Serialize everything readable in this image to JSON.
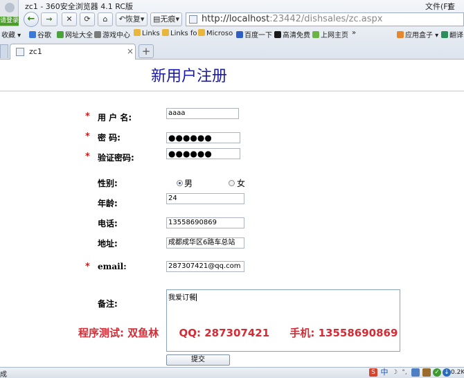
{
  "browser": {
    "window_title": "zc1 - 360安全浏览器 4.1 RC版",
    "menu_file": "文件(F)",
    "menu_view": "查",
    "login_label": "请登录",
    "restore_label": "恢复",
    "no_image_label": "无痕",
    "address": {
      "host": "http://localhost",
      "rest": ":23442/dishsales/zc.aspx"
    },
    "favorites": {
      "collect": "收藏",
      "items": [
        "谷歌",
        "网址大全",
        "游戏中心",
        "Links",
        "Links fo",
        "Microso",
        "百度一下",
        "高清免费",
        "上网主页"
      ],
      "more": "»",
      "app_box": "应用盒子",
      "translate": "翻译"
    },
    "tab": {
      "label": "zc1",
      "close": "×",
      "new_tab": "+"
    }
  },
  "page": {
    "title": "新用户注册",
    "form": {
      "required_mark": "*",
      "username_label": "用 户 名:",
      "username_value": "aaaa",
      "password_label": "密  码:",
      "password_value": "●●●●●●",
      "confirm_label": "验证密码:",
      "confirm_value": "●●●●●●",
      "gender_label": "性别:",
      "gender_male": "男",
      "gender_female": "女",
      "gender_selected": "男",
      "age_label": "年龄:",
      "age_value": "24",
      "phone_label": "电话:",
      "phone_value": "13558690869",
      "address_label": "地址:",
      "address_value": "成都成华区6路车总站",
      "email_label": "email:",
      "email_value": "287307421@qq.com",
      "remark_label": "备注:",
      "remark_value": "我爱订餐",
      "submit_label": "提交"
    },
    "overlay": {
      "tester": "程序测试: 双鱼林",
      "qq": "QQ: 287307421",
      "mobile": "手机: 13558690869"
    }
  },
  "statusbar": {
    "text": "成",
    "ime": "中",
    "zoom": "0.2K"
  }
}
